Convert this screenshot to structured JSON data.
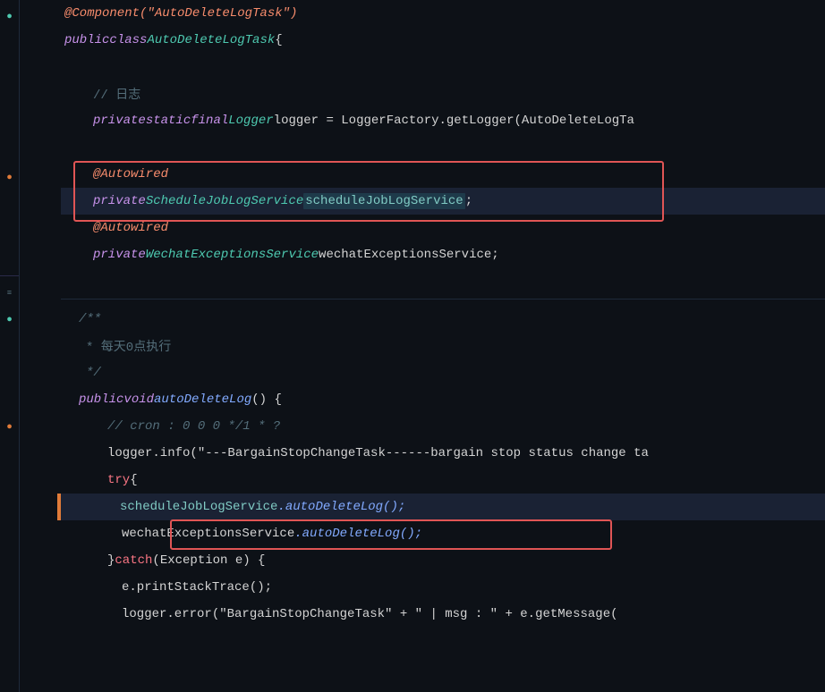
{
  "editor": {
    "background": "#0d1117",
    "lines": [
      {
        "lineNum": "",
        "indicator": null,
        "indent": 0,
        "tokens": [
          {
            "text": "@Component(\"AutoDeleteLogTask\")",
            "class": "annotation"
          }
        ]
      },
      {
        "lineNum": "",
        "indicator": {
          "color": "green"
        },
        "indent": 0,
        "tokens": [
          {
            "text": "public ",
            "class": "kw-public"
          },
          {
            "text": "class ",
            "class": "kw-class"
          },
          {
            "text": "AutoDeleteLogTask",
            "class": "class-name"
          },
          {
            "text": " {",
            "class": "plain"
          }
        ]
      },
      {
        "lineNum": "",
        "indicator": null,
        "indent": 0,
        "tokens": []
      },
      {
        "lineNum": "",
        "indicator": null,
        "indent": 2,
        "tokens": [
          {
            "text": "// 日志",
            "class": "comment-zh"
          }
        ]
      },
      {
        "lineNum": "",
        "indicator": null,
        "indent": 2,
        "tokens": [
          {
            "text": "private ",
            "class": "kw-private"
          },
          {
            "text": "static ",
            "class": "kw-static"
          },
          {
            "text": "final ",
            "class": "kw-final"
          },
          {
            "text": "Logger ",
            "class": "class-name"
          },
          {
            "text": "logger = LoggerFactory.getLogger(AutoDeleteLogTa",
            "class": "plain"
          }
        ]
      },
      {
        "lineNum": "",
        "indicator": null,
        "indent": 0,
        "tokens": []
      },
      {
        "lineNum": "",
        "indicator": null,
        "indent": 2,
        "tokens": [
          {
            "text": "@Autowired",
            "class": "annotation"
          }
        ],
        "highlight1Start": true
      },
      {
        "lineNum": "",
        "indicator": {
          "color": "orange"
        },
        "indent": 2,
        "tokens": [
          {
            "text": "private ",
            "class": "kw-private"
          },
          {
            "text": "ScheduleJobLogService ",
            "class": "class-name"
          },
          {
            "text": "scheduleJobLogService",
            "class": "highlighted"
          },
          {
            "text": ";",
            "class": "plain"
          }
        ],
        "highlight1End": true,
        "selectedLine": true
      },
      {
        "lineNum": "",
        "indicator": null,
        "indent": 2,
        "tokens": [
          {
            "text": "@Autowired",
            "class": "annotation"
          }
        ]
      },
      {
        "lineNum": "",
        "indicator": null,
        "indent": 2,
        "tokens": [
          {
            "text": "private ",
            "class": "kw-private"
          },
          {
            "text": "WechatExceptionsService ",
            "class": "class-name"
          },
          {
            "text": "wechatExceptionsService",
            "class": "plain"
          },
          {
            "text": ";",
            "class": "plain"
          }
        ]
      },
      {
        "lineNum": "",
        "indicator": null,
        "indent": 0,
        "tokens": []
      },
      {
        "lineNum": "",
        "indicator": null,
        "indent": 0,
        "tokens": [
          {
            "text": "  ",
            "class": "plain"
          },
          {
            "text": "/**",
            "class": "comment"
          }
        ]
      },
      {
        "lineNum": "",
        "indicator": null,
        "indent": 3,
        "tokens": [
          {
            "text": "* 每天0点执行",
            "class": "comment-zh"
          }
        ]
      },
      {
        "lineNum": "",
        "indicator": null,
        "indent": 3,
        "tokens": [
          {
            "text": "*/",
            "class": "comment"
          }
        ]
      },
      {
        "lineNum": "",
        "indicator": {
          "color": "teal"
        },
        "indent": 2,
        "tokens": [
          {
            "text": "public ",
            "class": "kw-public"
          },
          {
            "text": "void ",
            "class": "kw-void"
          },
          {
            "text": "autoDeleteLog",
            "class": "method-name"
          },
          {
            "text": "() {",
            "class": "plain"
          }
        ]
      },
      {
        "lineNum": "",
        "indicator": null,
        "indent": 3,
        "tokens": [
          {
            "text": "// cron : 0 0 0 */1 * ?",
            "class": "comment"
          }
        ]
      },
      {
        "lineNum": "",
        "indicator": null,
        "indent": 3,
        "tokens": [
          {
            "text": "logger.info(\"---BargainStopChangeTask------bargain stop status change ta",
            "class": "plain"
          }
        ]
      },
      {
        "lineNum": "",
        "indicator": null,
        "indent": 3,
        "tokens": [
          {
            "text": "try",
            "class": "kw-try"
          },
          {
            "text": " {",
            "class": "plain"
          }
        ]
      },
      {
        "lineNum": "",
        "indicator": {
          "color": "orange"
        },
        "indent": 4,
        "tokens": [
          {
            "text": "scheduleJobLogService",
            "class": "highlighted"
          },
          {
            "text": ".autoDeleteLog();",
            "class": "method-name"
          }
        ],
        "highlight2": true,
        "selectedLine": true,
        "orangeBar": true
      },
      {
        "lineNum": "",
        "indicator": null,
        "indent": 4,
        "tokens": [
          {
            "text": "wechatExceptionsService",
            "class": "plain"
          },
          {
            "text": ".autoDeleteLog();",
            "class": "method-name"
          }
        ]
      },
      {
        "lineNum": "",
        "indicator": null,
        "indent": 3,
        "tokens": [
          {
            "text": "} ",
            "class": "plain"
          },
          {
            "text": "catch",
            "class": "kw-catch"
          },
          {
            "text": " (Exception e) {",
            "class": "plain"
          }
        ]
      },
      {
        "lineNum": "",
        "indicator": null,
        "indent": 4,
        "tokens": [
          {
            "text": "e.printStackTrace();",
            "class": "plain"
          }
        ]
      },
      {
        "lineNum": "",
        "indicator": null,
        "indent": 4,
        "tokens": [
          {
            "text": "logger.error(\"BargainStopChangeTask\" + \" | msg : \" + e.getMessage(",
            "class": "plain"
          }
        ]
      }
    ]
  }
}
